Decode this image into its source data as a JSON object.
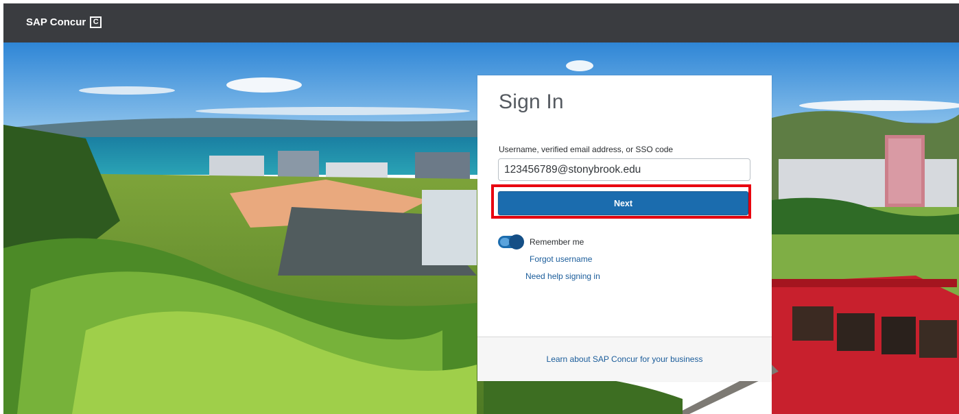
{
  "header": {
    "brand_text": "SAP Concur",
    "brand_mark": "C",
    "background_color": "#3a3c40"
  },
  "signin": {
    "title": "Sign In",
    "username_label": "Username, verified email address, or SSO code",
    "username_value": "123456789@stonybrook.edu",
    "next_label": "Next",
    "remember_label": "Remember me",
    "remember_checked": true,
    "forgot_username": "Forgot username",
    "need_help": "Need help signing in",
    "footer_link": "Learn about SAP Concur for your business"
  },
  "colors": {
    "primary": "#1b6cae",
    "highlight": "#e8000f",
    "link": "#1a5c9a"
  },
  "icons": {
    "brand_logo": "concur-c-logo-icon",
    "toggle": "toggle-switch-icon"
  }
}
